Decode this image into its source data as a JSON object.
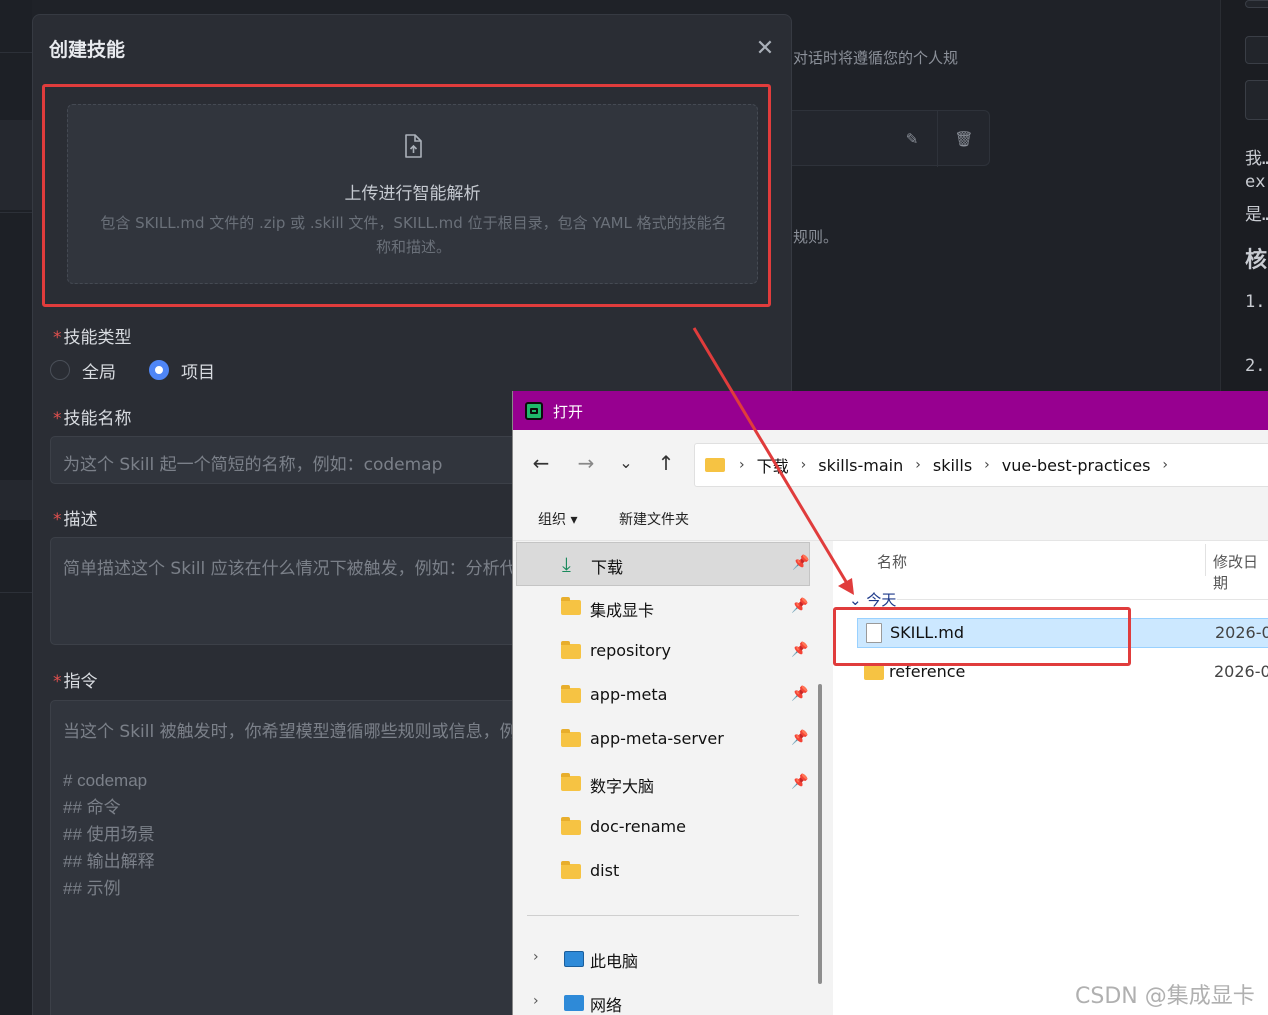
{
  "background": {
    "text_top": "对话时将遵循您的个人规",
    "text_mid": "规则。",
    "right_panel_lines": [
      "我…",
      "ex",
      "是…",
      "核",
      "1.",
      "2."
    ]
  },
  "modal": {
    "title": "创建技能",
    "close": "✕",
    "upload": {
      "title": "上传进行智能解析",
      "description": "包含 SKILL.md 文件的 .zip 或 .skill 文件，SKILL.md 位于根目录，包含 YAML 格式的技能名称和描述。"
    },
    "required_mark": "*",
    "skill_type": {
      "label": "技能类型",
      "options": [
        "全局",
        "项目"
      ],
      "selected": "项目"
    },
    "skill_name": {
      "label": "技能名称",
      "placeholder": "为这个 Skill 起一个简短的名称，例如：codemap"
    },
    "description": {
      "label": "描述",
      "placeholder": "简单描述这个 Skill 应该在什么情况下被触发，例如：分析代"
    },
    "instructions": {
      "label": "指令",
      "placeholder": "当这个 Skill 被触发时，你希望模型遵循哪些规则或信息，例",
      "example": "# codemap\n## 命令\n## 使用场景\n## 输出解释\n## 示例"
    }
  },
  "dialog": {
    "title": "打开",
    "nav": {
      "back": "←",
      "forward": "→",
      "recent": "⌄",
      "up": "↑"
    },
    "breadcrumb": [
      "下载",
      "skills-main",
      "skills",
      "vue-best-practices"
    ],
    "toolbar": {
      "organize": "组织 ▾",
      "new_folder": "新建文件夹"
    },
    "sidebar": [
      {
        "name": "下载",
        "pinned": true,
        "kind": "download"
      },
      {
        "name": "集成显卡",
        "pinned": true,
        "kind": "folder"
      },
      {
        "name": "repository",
        "pinned": true,
        "kind": "folder"
      },
      {
        "name": "app-meta",
        "pinned": true,
        "kind": "folder"
      },
      {
        "name": "app-meta-server",
        "pinned": true,
        "kind": "folder"
      },
      {
        "name": "数字大脑",
        "pinned": true,
        "kind": "folder"
      },
      {
        "name": "doc-rename",
        "pinned": false,
        "kind": "folder"
      },
      {
        "name": "dist",
        "pinned": false,
        "kind": "folder"
      }
    ],
    "sidebar_bottom": [
      "此电脑",
      "网络"
    ],
    "columns": {
      "name": "名称",
      "modified": "修改日期"
    },
    "group": "今天",
    "files": [
      {
        "name": "SKILL.md",
        "date": "2026-0",
        "kind": "file",
        "selected": true
      },
      {
        "name": "reference",
        "date": "2026-0",
        "kind": "folder",
        "selected": false
      }
    ]
  },
  "watermark": "CSDN @集成显卡",
  "colors": {
    "accent": "#4f86f7",
    "highlight": "#e03c3c",
    "dialog_title": "#970090"
  }
}
